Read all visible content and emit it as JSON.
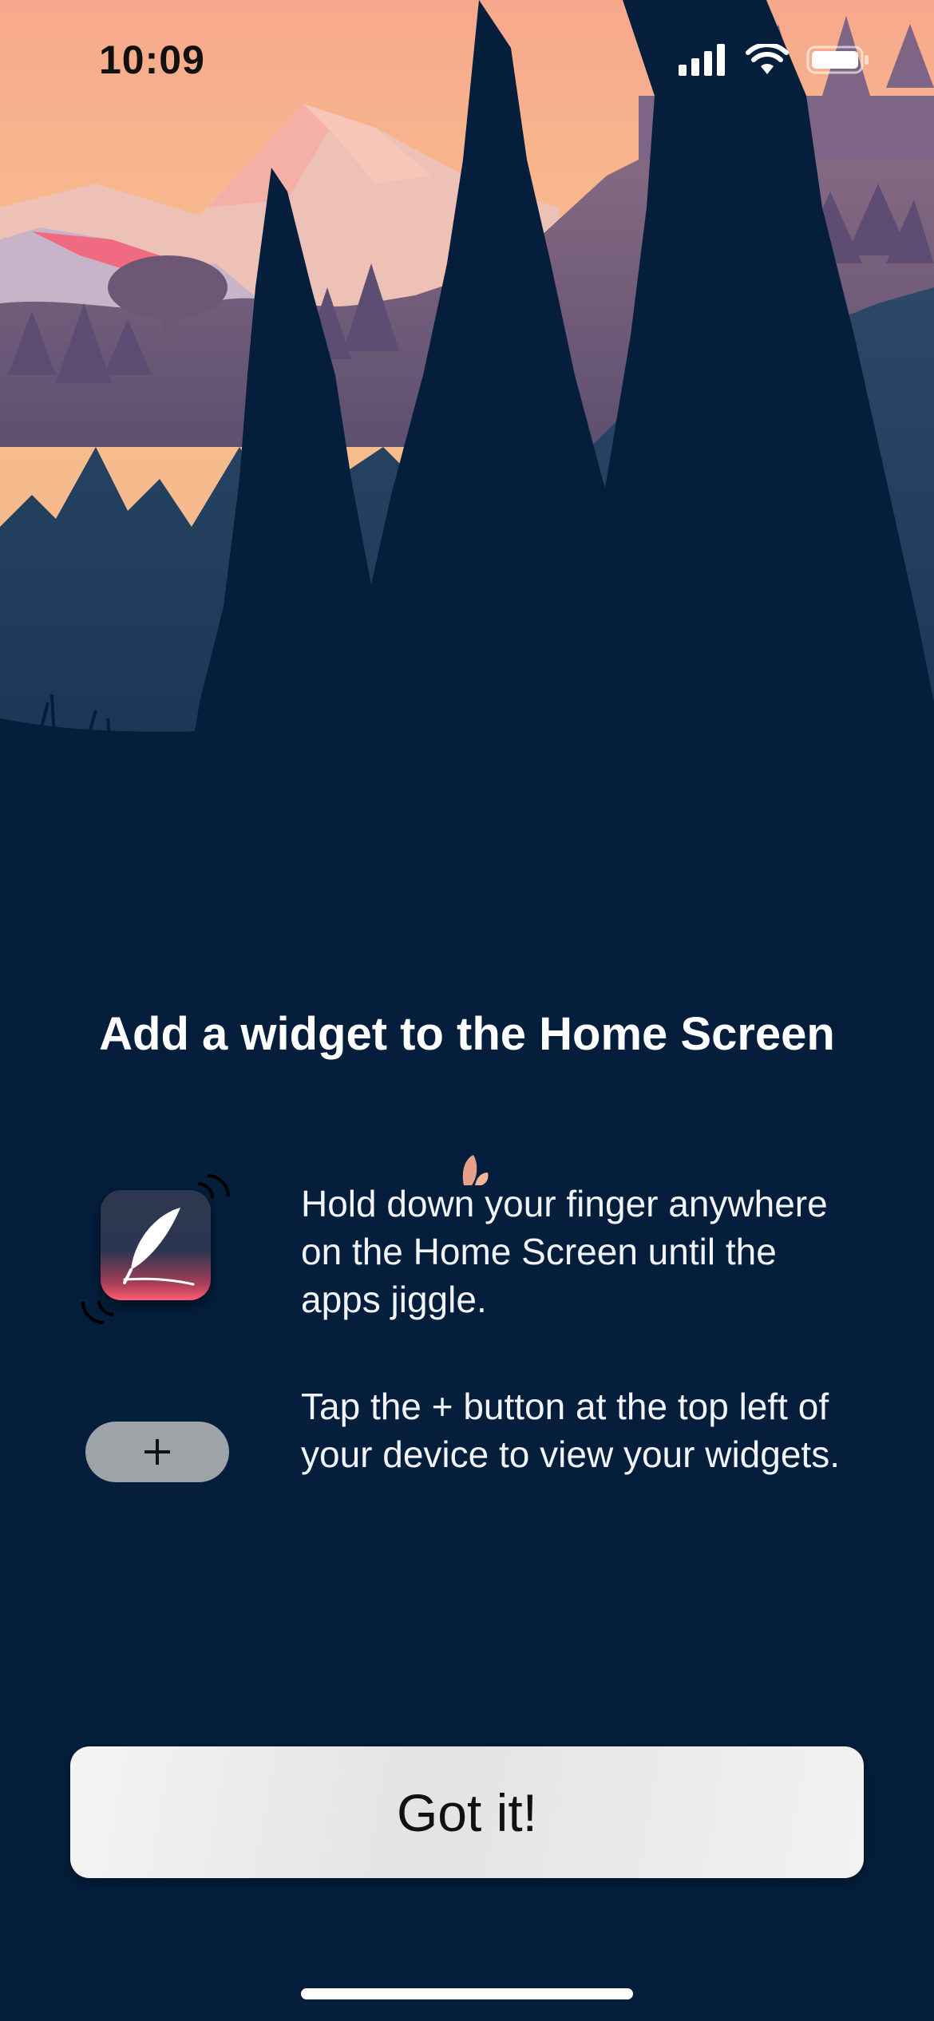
{
  "status_bar": {
    "time": "10:09",
    "icons": [
      "cellular-signal-icon",
      "wifi-icon",
      "battery-icon"
    ]
  },
  "hero": {
    "description_icon": "forest-illustration",
    "colors": {
      "sky_top": "#f7a58c",
      "sky_bottom": "#f6c08d",
      "tree_dark": "#041e3c"
    }
  },
  "title": "Add a widget to the Home Screen",
  "steps": [
    {
      "icon": "jiggling-app-icon",
      "text": "Hold down your finger anywhere on the Home Screen until the apps jiggle."
    },
    {
      "icon": "plus-button-icon",
      "button_symbol": "+",
      "text": "Tap the + button at the top left of your device to view your widgets."
    }
  ],
  "primary_button": {
    "label": "Got it!"
  },
  "colors": {
    "background": "#041e3c",
    "button_bg": "#ececec",
    "accent_pink": "#ff5c72"
  }
}
